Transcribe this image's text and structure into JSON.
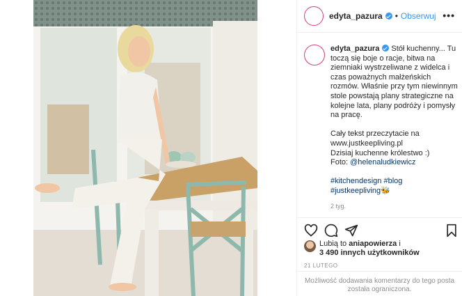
{
  "post": {
    "username": "edyta_pazura",
    "separator": "•",
    "follow_label": "Obserwuj",
    "more_label": "•••"
  },
  "caption": {
    "username": "edyta_pazura",
    "paragraph1": "Stół kuchenny... Tu toczą się boje o racje, bitwa na ziemniaki wystrzeliwane z widelca i czas poważnych małżeńskich rozmów. Właśnie przy tym niewinnym stole powstają plany strategiczne na kolejne lata, plany podróży i pomysły na pracę.",
    "paragraph2_line1": "Cały tekst przeczytacie na",
    "paragraph2_line2": "www.justkeepliving.pl",
    "paragraph2_line3": "Dzisiaj kuchenne królestwo :)",
    "paragraph2_line4_prefix": "Foto: ",
    "paragraph2_line4_mention": "@helenaludkiewicz",
    "hashtag1": "#kitchendesign",
    "hashtag2": "#blog",
    "hashtag3": "#justkeepliving",
    "hashtag_emoji": "🐝",
    "time_ago": "2 tyg."
  },
  "icons": [
    "heart-icon",
    "comment-icon",
    "share-icon",
    "bookmark-icon"
  ],
  "likes": {
    "prefix": "Lubią to ",
    "user": "aniapowierza",
    "middle": " i",
    "others": "3 490 innych użytkowników"
  },
  "date": "21 LUTEGO",
  "comments_disabled": "Możliwość dodawania komentarzy do tego posta została ograniczona.",
  "colors": {
    "link": "#3897f0",
    "hashtag": "#00376b",
    "muted": "#8e8e8e",
    "text": "#262626"
  }
}
